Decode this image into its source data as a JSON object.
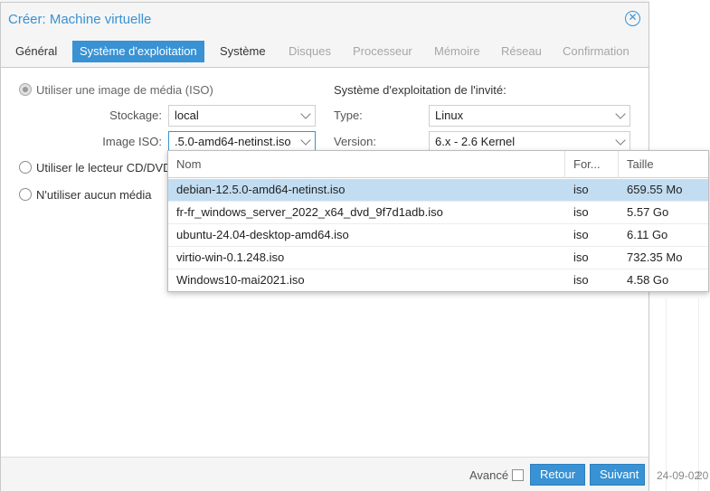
{
  "background": {
    "date_partial": "24-09-02",
    "date_cut": "20"
  },
  "dialog": {
    "title": "Créer: Machine virtuelle",
    "tabs": [
      {
        "label": "Général",
        "state": "normal"
      },
      {
        "label": "Système d'exploitation",
        "state": "active"
      },
      {
        "label": "Système",
        "state": "normal"
      },
      {
        "label": "Disques",
        "state": "disabled"
      },
      {
        "label": "Processeur",
        "state": "disabled"
      },
      {
        "label": "Mémoire",
        "state": "disabled"
      },
      {
        "label": "Réseau",
        "state": "disabled"
      },
      {
        "label": "Confirmation",
        "state": "disabled"
      }
    ]
  },
  "media": {
    "option_iso": "Utiliser une image de média (ISO)",
    "storage_label": "Stockage:",
    "storage_value": "local",
    "iso_label": "Image ISO:",
    "iso_value": ".5.0-amd64-netinst.iso",
    "option_cd": "Utiliser le lecteur CD/DVD",
    "option_none": "N'utiliser aucun média"
  },
  "guest_os": {
    "title": "Système d'exploitation de l'invité:",
    "type_label": "Type:",
    "type_value": "Linux",
    "version_label": "Version:",
    "version_value": "6.x - 2.6 Kernel"
  },
  "iso_list": {
    "columns": [
      "Nom",
      "For...",
      "Taille"
    ],
    "rows": [
      {
        "name": "debian-12.5.0-amd64-netinst.iso",
        "format": "iso",
        "size": "659.55 Mo"
      },
      {
        "name": "fr-fr_windows_server_2022_x64_dvd_9f7d1adb.iso",
        "format": "iso",
        "size": "5.57 Go"
      },
      {
        "name": "ubuntu-24.04-desktop-amd64.iso",
        "format": "iso",
        "size": "6.11 Go"
      },
      {
        "name": "virtio-win-0.1.248.iso",
        "format": "iso",
        "size": "732.35 Mo"
      },
      {
        "name": "Windows10-mai2021.iso",
        "format": "iso",
        "size": "4.58 Go"
      }
    ],
    "selected_index": 0
  },
  "footer": {
    "advanced_label": "Avancé",
    "back_label": "Retour",
    "next_label": "Suivant"
  },
  "colors": {
    "accent": "#3892d4",
    "selected_row": "#c2ddf2"
  }
}
